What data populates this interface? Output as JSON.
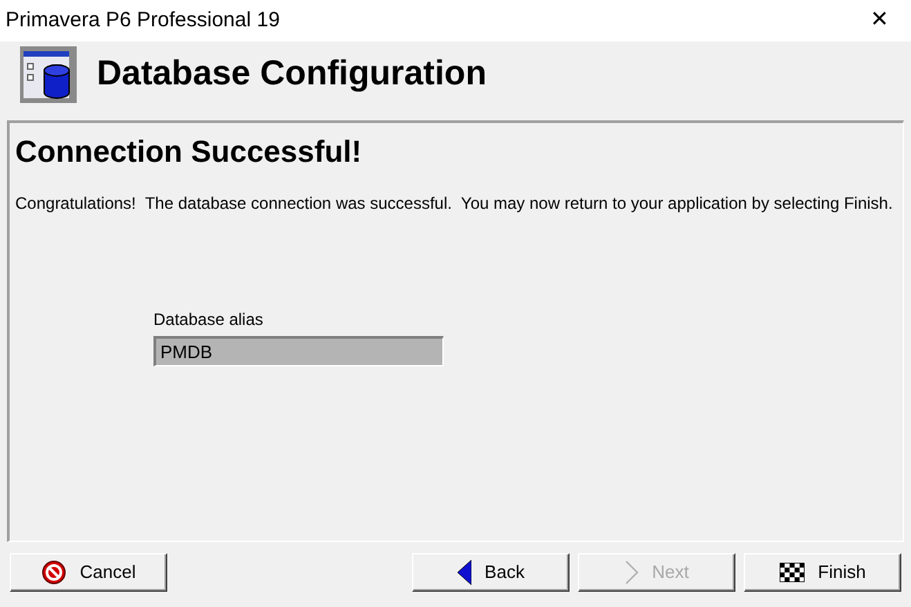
{
  "window": {
    "title": "Primavera P6 Professional 19",
    "close": "✕"
  },
  "header": {
    "title": "Database Configuration"
  },
  "panel": {
    "heading": "Connection Successful!",
    "message": "Congratulations!  The database connection was successful.  You may now return to your application by selecting Finish.",
    "alias": {
      "label": "Database alias",
      "value": "PMDB",
      "disabled": true
    }
  },
  "buttons": [
    {
      "kind": "cancel",
      "label": "Cancel",
      "disabled": false
    },
    {
      "kind": "back",
      "label": "Back",
      "disabled": false
    },
    {
      "kind": "next",
      "label": "Next",
      "disabled": true
    },
    {
      "kind": "finish",
      "label": "Finish",
      "disabled": false
    }
  ]
}
